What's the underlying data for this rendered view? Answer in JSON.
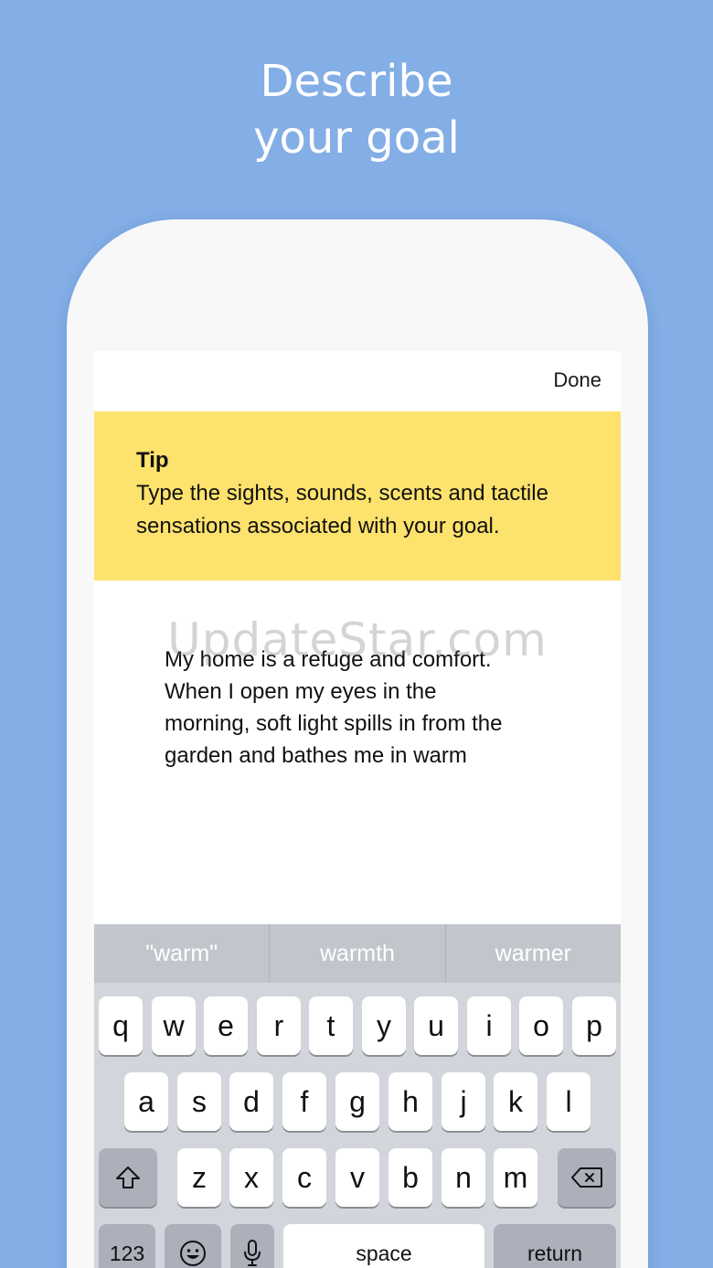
{
  "headline": {
    "line1": "Describe",
    "line2": "your goal"
  },
  "navbar": {
    "done_label": "Done"
  },
  "tip": {
    "title": "Tip",
    "body": "Type the sights, sounds, scents and tactile sensations associated with your goal."
  },
  "editor": {
    "lines": [
      "My home is a refuge and comfort.",
      "When I open my eyes in the",
      "morning, soft light spills in from the",
      "garden and bathes me in warm"
    ]
  },
  "watermark": "UpdateStar.com",
  "keyboard": {
    "suggestions": [
      "\"warm\"",
      "warmth",
      "warmer"
    ],
    "row1": [
      "q",
      "w",
      "e",
      "r",
      "t",
      "y",
      "u",
      "i",
      "o",
      "p"
    ],
    "row2": [
      "a",
      "s",
      "d",
      "f",
      "g",
      "h",
      "j",
      "k",
      "l"
    ],
    "row3": [
      "z",
      "x",
      "c",
      "v",
      "b",
      "n",
      "m"
    ],
    "numbers_label": "123",
    "space_label": "space",
    "return_label": "return",
    "icons": {
      "shift": "shift-icon",
      "delete": "delete-icon",
      "emoji": "emoji-icon",
      "mic": "microphone-icon"
    }
  },
  "colors": {
    "background": "#83aee6",
    "tip_panel": "#fde26d",
    "keyboard": "#d2d5db",
    "suggestion_bar": "#c2c6cc"
  }
}
